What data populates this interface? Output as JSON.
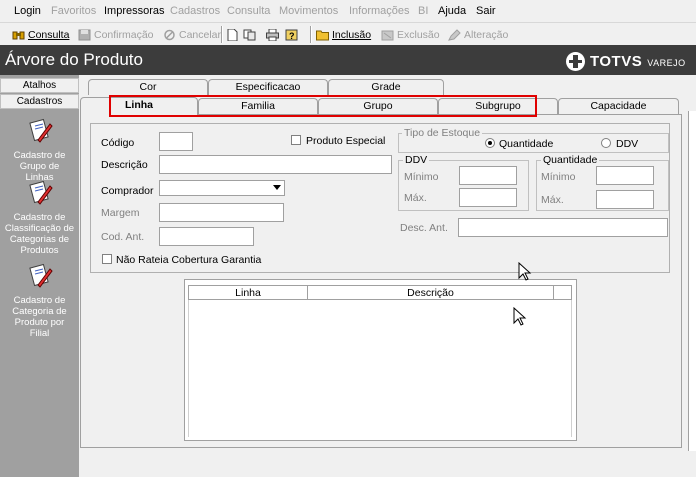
{
  "menubar": {
    "items": [
      {
        "label": "Login",
        "enabled": true
      },
      {
        "label": "Favoritos",
        "enabled": false
      },
      {
        "label": "Impressoras",
        "enabled": true
      },
      {
        "label": "Cadastros",
        "enabled": false
      },
      {
        "label": "Consulta",
        "enabled": false
      },
      {
        "label": "Movimentos",
        "enabled": false
      },
      {
        "label": "Informações",
        "enabled": false
      },
      {
        "label": "BI",
        "enabled": false
      },
      {
        "label": "Ajuda",
        "enabled": true
      },
      {
        "label": "Sair",
        "enabled": true
      }
    ]
  },
  "toolbar": {
    "consulta": "Consulta",
    "confirmacao": "Confirmação",
    "cancelar": "Cancelar",
    "inclusao": "Inclusão",
    "exclusao": "Exclusão",
    "alteracao": "Alteração"
  },
  "titlebar": {
    "title": "Árvore do Produto",
    "logo_text": "TOTVS",
    "logo_sub": "VAREJO"
  },
  "sidebar": {
    "tabs": [
      "Atalhos",
      "Cadastros"
    ],
    "items": [
      {
        "label": "Cadastro de Grupo de Linhas",
        "icon": "document-pencil-icon"
      },
      {
        "label": "Cadastro de Classificação de Categorias de Produtos",
        "icon": "document-pencil-icon"
      },
      {
        "label": "Cadastro de Categoria de Produto por Filial",
        "icon": "document-pencil-icon"
      }
    ]
  },
  "tabs": {
    "back_row": [
      "Cor",
      "Especificacao",
      "Grade"
    ],
    "front_row": [
      "Linha",
      "Familia",
      "Grupo",
      "Subgrupo",
      "Capacidade"
    ],
    "selected": "Linha"
  },
  "form": {
    "codigo_label": "Código",
    "descricao_label": "Descrição",
    "comprador_label": "Comprador",
    "margem_label": "Margem",
    "cod_ant_label": "Cod. Ant.",
    "produto_especial_label": "Produto Especial",
    "nao_rateia_label": "Não Rateia Cobertura Garantia",
    "tipo_estoque_label": "Tipo de Estoque",
    "quantidade_radio": "Quantidade",
    "ddv_radio": "DDV",
    "tipo_estoque_selected": "Quantidade",
    "ddv_group_label": "DDV",
    "quantidade_group_label": "Quantidade",
    "minimo_label": "Mínimo",
    "maximo_label": "Máx.",
    "desc_ant_label": "Desc. Ant."
  },
  "grid": {
    "columns": [
      "Linha",
      "Descrição"
    ],
    "rows": []
  },
  "colors": {
    "titlebar": "#3c3c3c",
    "sidebar": "#a0a0a0",
    "highlight": "#e00000"
  }
}
